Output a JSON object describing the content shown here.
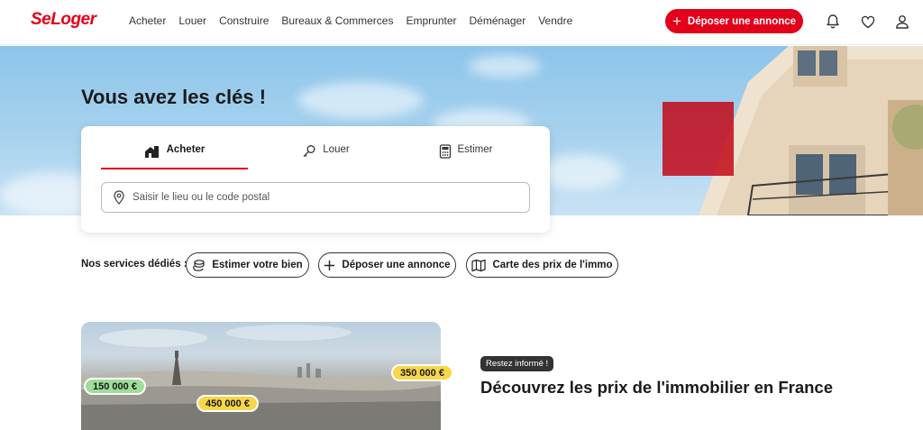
{
  "header": {
    "logo": "SeLoger",
    "nav": [
      "Acheter",
      "Louer",
      "Construire",
      "Bureaux & Commerces",
      "Emprunter",
      "Déménager",
      "Vendre"
    ],
    "cta_plus": "+",
    "cta_label": "Déposer une annonce",
    "icons": [
      "bell-icon",
      "heart-icon",
      "user-icon"
    ]
  },
  "hero": {
    "title": "Vous avez les clés !"
  },
  "search_card": {
    "tabs": [
      {
        "label": "Acheter",
        "icon": "house-key-icon",
        "active": true
      },
      {
        "label": "Louer",
        "icon": "key-icon",
        "active": false
      },
      {
        "label": "Estimer",
        "icon": "calculator-icon",
        "active": false
      }
    ],
    "search_placeholder": "Saisir le lieu ou le code postal"
  },
  "services": {
    "label": "Nos services dédiés :",
    "pills": [
      {
        "label": "Estimer votre bien",
        "icon": "coins-icon"
      },
      {
        "label": "Déposer une annonce",
        "icon": "plus-icon"
      },
      {
        "label": "Carte des prix de l'immo",
        "icon": "map-icon"
      }
    ]
  },
  "promo": {
    "prices": [
      "150 000 €",
      "450 000 €",
      "350 000 €"
    ],
    "badge": "Restez informé !",
    "title": "Découvrez les prix de l'immobilier en France"
  },
  "colors": {
    "brand": "#e2001a",
    "price_green": "#9fdd9a",
    "price_yellow": "#f7d64a"
  }
}
